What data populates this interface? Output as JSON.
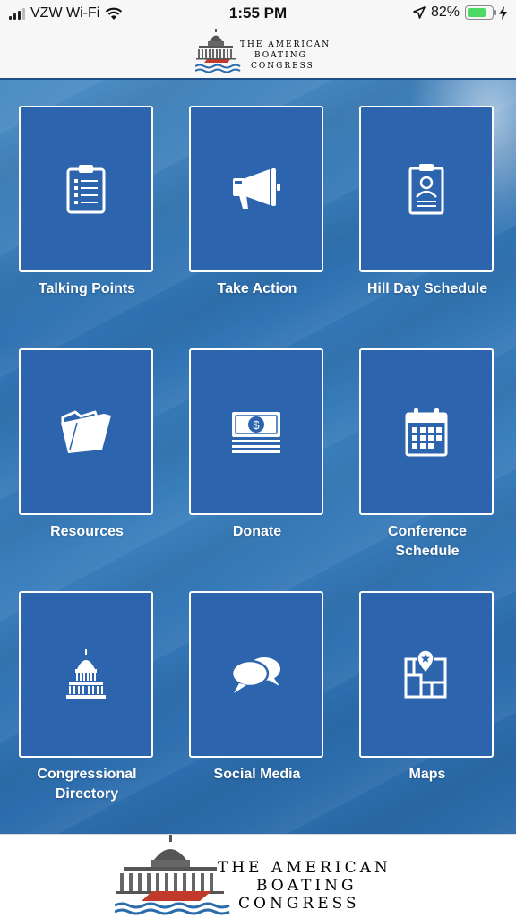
{
  "status_bar": {
    "carrier": "VZW Wi-Fi",
    "time": "1:55 PM",
    "battery_pct": "82%",
    "battery_level": 0.82
  },
  "header": {
    "logo_line1": "THE AMERICAN",
    "logo_line2": "BOATING",
    "logo_line3": "CONGRESS"
  },
  "tiles": [
    {
      "label": "Talking Points",
      "icon": "clipboard-list-icon"
    },
    {
      "label": "Take Action",
      "icon": "megaphone-icon"
    },
    {
      "label": "Hill Day Schedule",
      "icon": "id-badge-icon"
    },
    {
      "label": "Resources",
      "icon": "folder-icon"
    },
    {
      "label": "Donate",
      "icon": "money-icon"
    },
    {
      "label": "Conference\nSchedule",
      "label_line1": "Conference",
      "label_line2": "Schedule",
      "icon": "calendar-icon"
    },
    {
      "label": "Congressional\nDirectory",
      "label_line1": "Congressional",
      "label_line2": "Directory",
      "icon": "capitol-icon"
    },
    {
      "label": "Social Media",
      "icon": "chat-bubbles-icon"
    },
    {
      "label": "Maps",
      "icon": "map-pin-icon"
    }
  ],
  "footer": {
    "logo_line1": "THE AMERICAN",
    "logo_line2": "BOATING",
    "logo_line3": "CONGRESS"
  },
  "colors": {
    "tile_bg": "#2c65ad",
    "tile_border": "#ffffff",
    "boat_red": "#c0392b",
    "water_blue": "#2a6cab"
  }
}
